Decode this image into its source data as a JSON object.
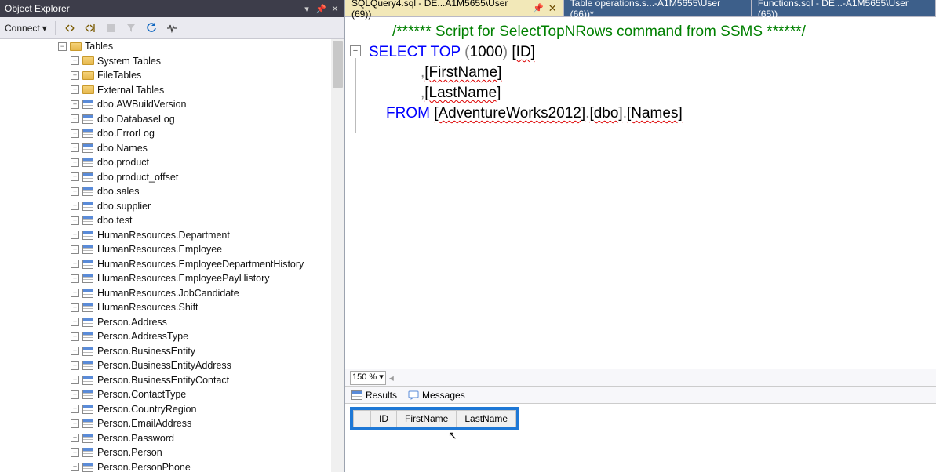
{
  "panel": {
    "title": "Object Explorer",
    "connect_label": "Connect"
  },
  "tree": {
    "root_label": "Tables",
    "folders": [
      "System Tables",
      "FileTables",
      "External Tables"
    ],
    "tables": [
      "dbo.AWBuildVersion",
      "dbo.DatabaseLog",
      "dbo.ErrorLog",
      "dbo.Names",
      "dbo.product",
      "dbo.product_offset",
      "dbo.sales",
      "dbo.supplier",
      "dbo.test",
      "HumanResources.Department",
      "HumanResources.Employee",
      "HumanResources.EmployeeDepartmentHistory",
      "HumanResources.EmployeePayHistory",
      "HumanResources.JobCandidate",
      "HumanResources.Shift",
      "Person.Address",
      "Person.AddressType",
      "Person.BusinessEntity",
      "Person.BusinessEntityAddress",
      "Person.BusinessEntityContact",
      "Person.ContactType",
      "Person.CountryRegion",
      "Person.EmailAddress",
      "Person.Password",
      "Person.Person",
      "Person.PersonPhone"
    ]
  },
  "tabs": [
    {
      "label": "SQLQuery4.sql - DE...A1M5655\\User (69))",
      "active": true
    },
    {
      "label": "Table operations.s...-A1M5655\\User (66))*",
      "active": false
    },
    {
      "label": "Functions.sql - DE...-A1M5655\\User (65))",
      "active": false
    }
  ],
  "sql": {
    "comment": "/****** Script for SelectTopNRows command from SSMS  ******/",
    "select": "SELECT",
    "top": "TOP",
    "lparen": "(",
    "num": "1000",
    "rparen": ")",
    "col_id": "[ID]",
    "comma1": ",",
    "col_first": "[FirstName]",
    "comma2": ",",
    "col_last": "[LastName]",
    "from": "FROM",
    "db": "[AdventureWorks2012]",
    "dot1": ".",
    "schema": "[dbo]",
    "dot2": ".",
    "table": "[Names]"
  },
  "zoom": "150 %",
  "result_tabs": {
    "results": "Results",
    "messages": "Messages"
  },
  "grid_headers": [
    "ID",
    "FirstName",
    "LastName"
  ]
}
